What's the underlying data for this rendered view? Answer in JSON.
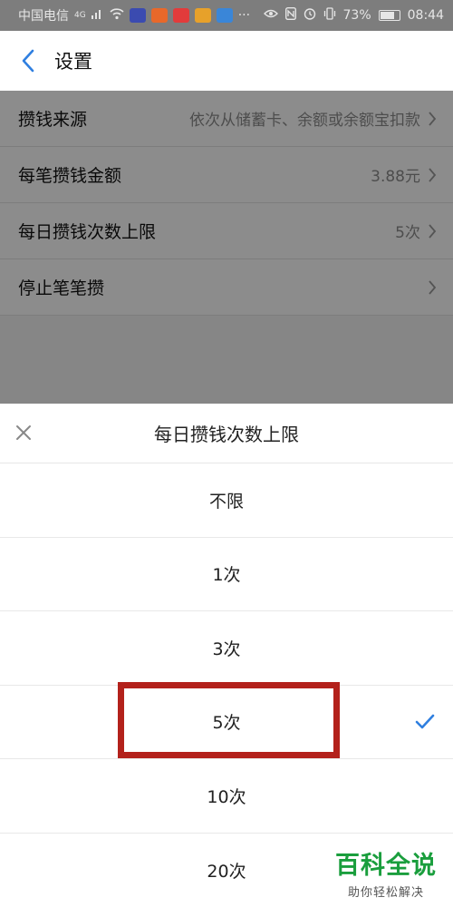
{
  "status_bar": {
    "carrier": "中国电信",
    "network": "4G",
    "battery": "73%",
    "time": "08:44"
  },
  "nav": {
    "back_icon": "chevron-left-icon",
    "title": "设置"
  },
  "settings": [
    {
      "label": "攒钱来源",
      "value": "依次从储蓄卡、余额或余额宝扣款"
    },
    {
      "label": "每笔攒钱金额",
      "value": "3.88元"
    },
    {
      "label": "每日攒钱次数上限",
      "value": "5次"
    },
    {
      "label": "停止笔笔攒",
      "value": ""
    }
  ],
  "sheet": {
    "title": "每日攒钱次数上限",
    "close_icon": "close-icon",
    "options": [
      "不限",
      "1次",
      "3次",
      "5次",
      "10次",
      "20次"
    ],
    "selected": "5次"
  },
  "watermark": {
    "main": "百科全说",
    "sub": "助你轻松解决"
  },
  "colors": {
    "accent": "#2f7fe0",
    "highlight": "#b3211b",
    "watermark": "#1a9e3d"
  }
}
